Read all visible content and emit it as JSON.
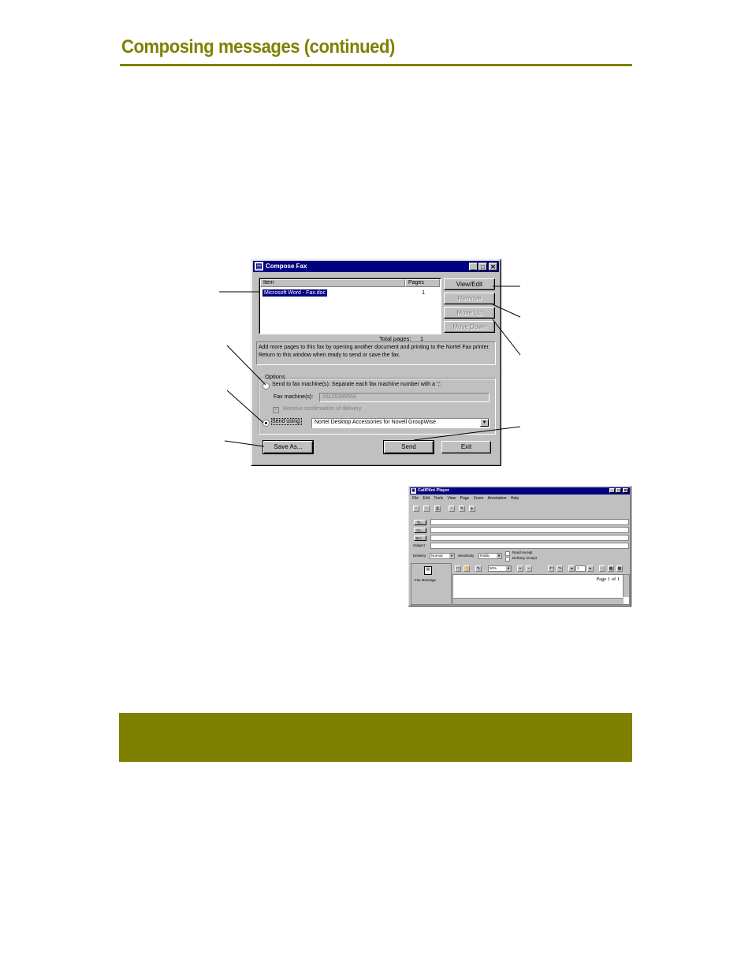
{
  "page": {
    "title": "Composing messages (continued)"
  },
  "compose_fax": {
    "title": "Compose Fax",
    "list_headers": [
      "Item",
      "Pages"
    ],
    "list_rows": [
      {
        "item": "Microsoft Word - Fax.doc",
        "pages": "1"
      }
    ],
    "buttons": {
      "view_edit": "View/Edit",
      "remove": "Remove",
      "move_up": "Move Up",
      "move_down": "Move Down",
      "save_as": "Save As...",
      "send": "Send",
      "exit": "Exit"
    },
    "total_pages_label": "Total pages:",
    "total_pages_value": "1",
    "info_text": "Add more pages to this fax by opening another document and printing to the Nortel Fax printer. Return to this window when ready to send or save the fax.",
    "options_label": "Options",
    "radio_fax_machine": "Send to fax machine(s). Separate each fax machine number with a ';'.",
    "fax_machines_label": "Fax machine(s):",
    "fax_machines_value": "16125345564",
    "receive_confirmation": "Receive confirmation of delivery",
    "radio_send_using": "Send using:",
    "send_using_value": "Nortel Desktop Accessories for Novell GroupWise"
  },
  "callpilot": {
    "title": "CallPilot Player",
    "menu": [
      "File",
      "Edit",
      "Tools",
      "View",
      "Page",
      "Zoom",
      "Annotation",
      "Help"
    ],
    "address_buttons": [
      "To...",
      "Cc...",
      "Bcc..."
    ],
    "subject_label": "Subject",
    "delivery_label": "Delivery",
    "delivery_value": "Normal",
    "sensitivity_label": "Sensitivity",
    "sensitivity_value": "Public",
    "read_receipt": "Read receipt",
    "delivery_receipt": "Delivery receipt",
    "attachment_label": "Fax Message",
    "zoom_value": "50%",
    "page_field": "1",
    "page_info": "Page 1 of 1"
  }
}
